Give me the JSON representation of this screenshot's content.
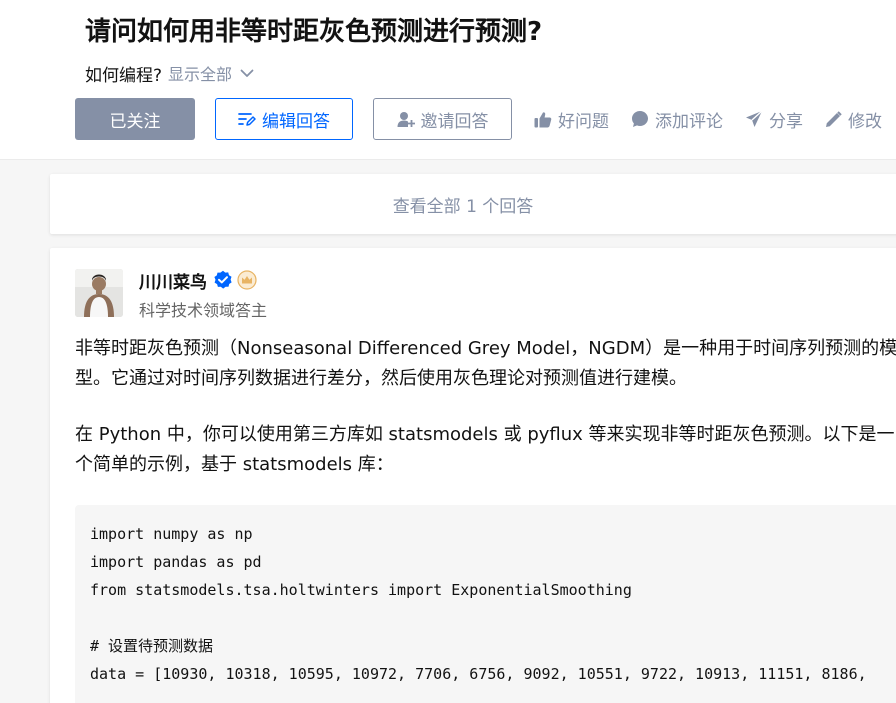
{
  "question": {
    "title": "请问如何用非等时距灰色预测进行预测?",
    "detail": "如何编程?",
    "expand_label": "显示全部"
  },
  "actions": {
    "followed_label": "已关注",
    "edit_label": "编辑回答",
    "invite_label": "邀请回答",
    "good_question_label": "好问题",
    "comment_label": "添加评论",
    "share_label": "分享",
    "edit_question_label": "修改"
  },
  "view_all": {
    "label": "查看全部 1 个回答"
  },
  "answer": {
    "author": {
      "name": "川川菜鸟",
      "headline": "科学技术领域答主"
    },
    "paragraphs": [
      "非等时距灰色预测（Nonseasonal Differenced Grey Model，NGDM）是一种用于时间序列预测的模型。它通过对时间序列数据进行差分，然后使用灰色理论对预测值进行建模。",
      "在 Python 中，你可以使用第三方库如 statsmodels 或 pyflux 等来实现非等时距灰色预测。以下是一个简单的示例，基于 statsmodels 库："
    ],
    "code_lines": [
      "import numpy as np",
      "import pandas as pd",
      "from statsmodels.tsa.holtwinters import ExponentialSmoothing",
      "",
      "# 设置待预测数据",
      "data = [10930, 10318, 10595, 10972, 7706, 6756, 9092, 10551, 9722, 10913, 11151, 8186,"
    ]
  },
  "colors": {
    "brand_blue": "#0066ff",
    "muted_gray": "#8590a6",
    "verified_blue": "#0066ff",
    "crown_gold": "#e8b464"
  }
}
